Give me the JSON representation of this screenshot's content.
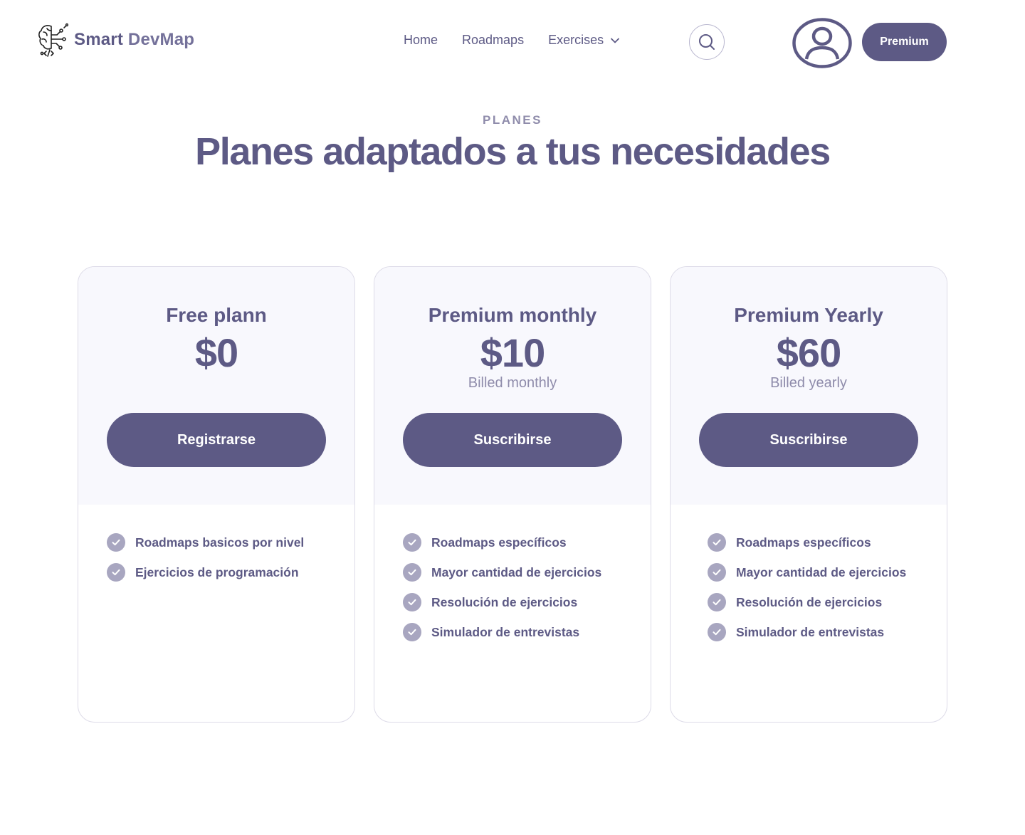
{
  "header": {
    "brand": {
      "name_part1": "Smart ",
      "name_part2": "DevMap",
      "logo_icon": "brain-circuit-icon"
    },
    "nav": [
      {
        "label": "Home"
      },
      {
        "label": "Roadmaps"
      },
      {
        "label": "Exercises",
        "has_dropdown": true
      }
    ],
    "search_icon": "search-icon",
    "avatar_icon": "user-circle-icon",
    "premium_label": "Premium"
  },
  "hero": {
    "eyebrow": "PLANES",
    "title": "Planes adaptados a tus necesidades"
  },
  "colors": {
    "primary": "#5d5a85",
    "muted": "#8f8cab",
    "card_top_bg": "#f8f8fd",
    "check_bg": "#a8a6c0"
  },
  "plans": [
    {
      "name": "Free plann",
      "price": "$0",
      "billing": "",
      "cta": "Registrarse",
      "features": [
        "Roadmaps basicos por nivel",
        "Ejercicios de programación"
      ]
    },
    {
      "name": "Premium monthly",
      "price": "$10",
      "billing": "Billed monthly",
      "cta": "Suscribirse",
      "features": [
        "Roadmaps específicos",
        "Mayor cantidad de ejercicios",
        "Resolución de ejercicios",
        "Simulador de entrevistas"
      ]
    },
    {
      "name": "Premium Yearly",
      "price": "$60",
      "billing": "Billed yearly",
      "cta": "Suscribirse",
      "features": [
        "Roadmaps específicos",
        "Mayor cantidad de ejercicios",
        "Resolución de ejercicios",
        "Simulador de entrevistas"
      ]
    }
  ]
}
